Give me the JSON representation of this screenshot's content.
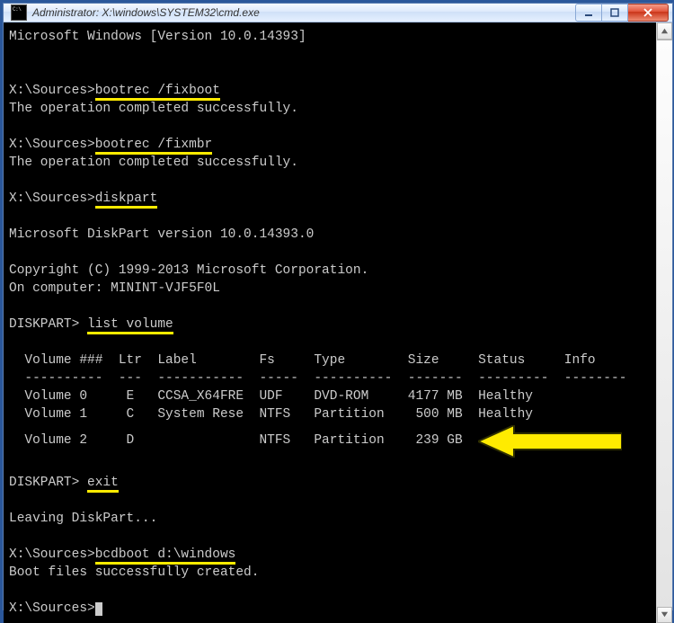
{
  "window": {
    "title": "Administrator: X:\\windows\\SYSTEM32\\cmd.exe"
  },
  "banner": {
    "line1": "Microsoft Windows [Version 10.0.14393]"
  },
  "cmd1": {
    "prompt": "X:\\Sources>",
    "command": "bootrec /fixboot",
    "result": "The operation completed successfully."
  },
  "cmd2": {
    "prompt": "X:\\Sources>",
    "command": "bootrec /fixmbr",
    "result": "The operation completed successfully."
  },
  "cmd3": {
    "prompt": "X:\\Sources>",
    "command": "diskpart"
  },
  "diskpart": {
    "version": "Microsoft DiskPart version 10.0.14393.0",
    "copyright": "Copyright (C) 1999-2013 Microsoft Corporation.",
    "computer": "On computer: MININT-VJF5F0L",
    "dp_prompt": "DISKPART> ",
    "listcmd": "list volume",
    "header": "  Volume ###  Ltr  Label        Fs     Type        Size     Status     Info",
    "divider": "  ----------  ---  -----------  -----  ----------  -------  ---------  --------",
    "row0": "  Volume 0     E   CCSA_X64FRE  UDF    DVD-ROM     4177 MB  Healthy",
    "row1": "  Volume 1     C   System Rese  NTFS   Partition    500 MB  Healthy",
    "row2": "  Volume 2     D                NTFS   Partition    239 GB  ",
    "exitcmd": "exit",
    "leaving": "Leaving DiskPart..."
  },
  "cmd4": {
    "prompt": "X:\\Sources>",
    "command": "bcdboot d:\\windows",
    "result": "Boot files successfully created."
  },
  "final_prompt": "X:\\Sources>",
  "volumes": [
    {
      "num": 0,
      "ltr": "E",
      "label": "CCSA_X64FRE",
      "fs": "UDF",
      "type": "DVD-ROM",
      "size": "4177 MB",
      "status": "Healthy"
    },
    {
      "num": 1,
      "ltr": "C",
      "label": "System Rese",
      "fs": "NTFS",
      "type": "Partition",
      "size": "500 MB",
      "status": "Healthy"
    },
    {
      "num": 2,
      "ltr": "D",
      "label": "",
      "fs": "NTFS",
      "type": "Partition",
      "size": "239 GB",
      "status": ""
    }
  ],
  "highlight_color": "#ffeb00"
}
